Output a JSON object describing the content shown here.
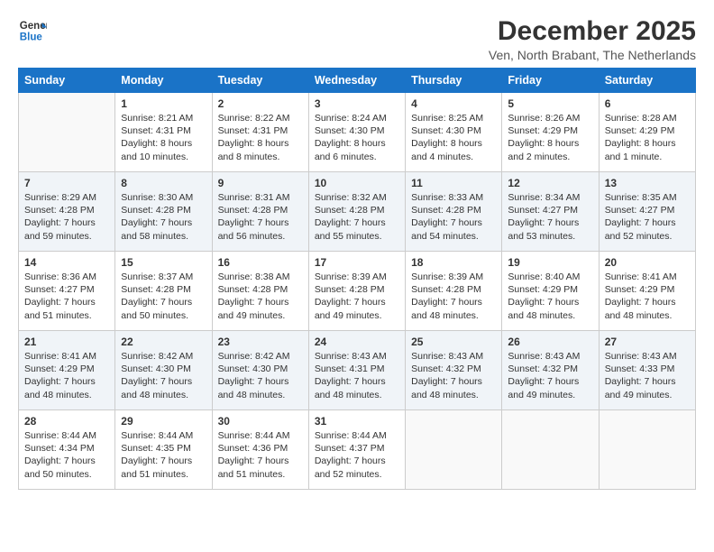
{
  "logo": {
    "line1": "General",
    "line2": "Blue"
  },
  "title": "December 2025",
  "subtitle": "Ven, North Brabant, The Netherlands",
  "days_header": [
    "Sunday",
    "Monday",
    "Tuesday",
    "Wednesday",
    "Thursday",
    "Friday",
    "Saturday"
  ],
  "weeks": [
    [
      {
        "day": "",
        "lines": []
      },
      {
        "day": "1",
        "lines": [
          "Sunrise: 8:21 AM",
          "Sunset: 4:31 PM",
          "Daylight: 8 hours",
          "and 10 minutes."
        ]
      },
      {
        "day": "2",
        "lines": [
          "Sunrise: 8:22 AM",
          "Sunset: 4:31 PM",
          "Daylight: 8 hours",
          "and 8 minutes."
        ]
      },
      {
        "day": "3",
        "lines": [
          "Sunrise: 8:24 AM",
          "Sunset: 4:30 PM",
          "Daylight: 8 hours",
          "and 6 minutes."
        ]
      },
      {
        "day": "4",
        "lines": [
          "Sunrise: 8:25 AM",
          "Sunset: 4:30 PM",
          "Daylight: 8 hours",
          "and 4 minutes."
        ]
      },
      {
        "day": "5",
        "lines": [
          "Sunrise: 8:26 AM",
          "Sunset: 4:29 PM",
          "Daylight: 8 hours",
          "and 2 minutes."
        ]
      },
      {
        "day": "6",
        "lines": [
          "Sunrise: 8:28 AM",
          "Sunset: 4:29 PM",
          "Daylight: 8 hours",
          "and 1 minute."
        ]
      }
    ],
    [
      {
        "day": "7",
        "lines": [
          "Sunrise: 8:29 AM",
          "Sunset: 4:28 PM",
          "Daylight: 7 hours",
          "and 59 minutes."
        ]
      },
      {
        "day": "8",
        "lines": [
          "Sunrise: 8:30 AM",
          "Sunset: 4:28 PM",
          "Daylight: 7 hours",
          "and 58 minutes."
        ]
      },
      {
        "day": "9",
        "lines": [
          "Sunrise: 8:31 AM",
          "Sunset: 4:28 PM",
          "Daylight: 7 hours",
          "and 56 minutes."
        ]
      },
      {
        "day": "10",
        "lines": [
          "Sunrise: 8:32 AM",
          "Sunset: 4:28 PM",
          "Daylight: 7 hours",
          "and 55 minutes."
        ]
      },
      {
        "day": "11",
        "lines": [
          "Sunrise: 8:33 AM",
          "Sunset: 4:28 PM",
          "Daylight: 7 hours",
          "and 54 minutes."
        ]
      },
      {
        "day": "12",
        "lines": [
          "Sunrise: 8:34 AM",
          "Sunset: 4:27 PM",
          "Daylight: 7 hours",
          "and 53 minutes."
        ]
      },
      {
        "day": "13",
        "lines": [
          "Sunrise: 8:35 AM",
          "Sunset: 4:27 PM",
          "Daylight: 7 hours",
          "and 52 minutes."
        ]
      }
    ],
    [
      {
        "day": "14",
        "lines": [
          "Sunrise: 8:36 AM",
          "Sunset: 4:27 PM",
          "Daylight: 7 hours",
          "and 51 minutes."
        ]
      },
      {
        "day": "15",
        "lines": [
          "Sunrise: 8:37 AM",
          "Sunset: 4:28 PM",
          "Daylight: 7 hours",
          "and 50 minutes."
        ]
      },
      {
        "day": "16",
        "lines": [
          "Sunrise: 8:38 AM",
          "Sunset: 4:28 PM",
          "Daylight: 7 hours",
          "and 49 minutes."
        ]
      },
      {
        "day": "17",
        "lines": [
          "Sunrise: 8:39 AM",
          "Sunset: 4:28 PM",
          "Daylight: 7 hours",
          "and 49 minutes."
        ]
      },
      {
        "day": "18",
        "lines": [
          "Sunrise: 8:39 AM",
          "Sunset: 4:28 PM",
          "Daylight: 7 hours",
          "and 48 minutes."
        ]
      },
      {
        "day": "19",
        "lines": [
          "Sunrise: 8:40 AM",
          "Sunset: 4:29 PM",
          "Daylight: 7 hours",
          "and 48 minutes."
        ]
      },
      {
        "day": "20",
        "lines": [
          "Sunrise: 8:41 AM",
          "Sunset: 4:29 PM",
          "Daylight: 7 hours",
          "and 48 minutes."
        ]
      }
    ],
    [
      {
        "day": "21",
        "lines": [
          "Sunrise: 8:41 AM",
          "Sunset: 4:29 PM",
          "Daylight: 7 hours",
          "and 48 minutes."
        ]
      },
      {
        "day": "22",
        "lines": [
          "Sunrise: 8:42 AM",
          "Sunset: 4:30 PM",
          "Daylight: 7 hours",
          "and 48 minutes."
        ]
      },
      {
        "day": "23",
        "lines": [
          "Sunrise: 8:42 AM",
          "Sunset: 4:30 PM",
          "Daylight: 7 hours",
          "and 48 minutes."
        ]
      },
      {
        "day": "24",
        "lines": [
          "Sunrise: 8:43 AM",
          "Sunset: 4:31 PM",
          "Daylight: 7 hours",
          "and 48 minutes."
        ]
      },
      {
        "day": "25",
        "lines": [
          "Sunrise: 8:43 AM",
          "Sunset: 4:32 PM",
          "Daylight: 7 hours",
          "and 48 minutes."
        ]
      },
      {
        "day": "26",
        "lines": [
          "Sunrise: 8:43 AM",
          "Sunset: 4:32 PM",
          "Daylight: 7 hours",
          "and 49 minutes."
        ]
      },
      {
        "day": "27",
        "lines": [
          "Sunrise: 8:43 AM",
          "Sunset: 4:33 PM",
          "Daylight: 7 hours",
          "and 49 minutes."
        ]
      }
    ],
    [
      {
        "day": "28",
        "lines": [
          "Sunrise: 8:44 AM",
          "Sunset: 4:34 PM",
          "Daylight: 7 hours",
          "and 50 minutes."
        ]
      },
      {
        "day": "29",
        "lines": [
          "Sunrise: 8:44 AM",
          "Sunset: 4:35 PM",
          "Daylight: 7 hours",
          "and 51 minutes."
        ]
      },
      {
        "day": "30",
        "lines": [
          "Sunrise: 8:44 AM",
          "Sunset: 4:36 PM",
          "Daylight: 7 hours",
          "and 51 minutes."
        ]
      },
      {
        "day": "31",
        "lines": [
          "Sunrise: 8:44 AM",
          "Sunset: 4:37 PM",
          "Daylight: 7 hours",
          "and 52 minutes."
        ]
      },
      {
        "day": "",
        "lines": []
      },
      {
        "day": "",
        "lines": []
      },
      {
        "day": "",
        "lines": []
      }
    ]
  ]
}
